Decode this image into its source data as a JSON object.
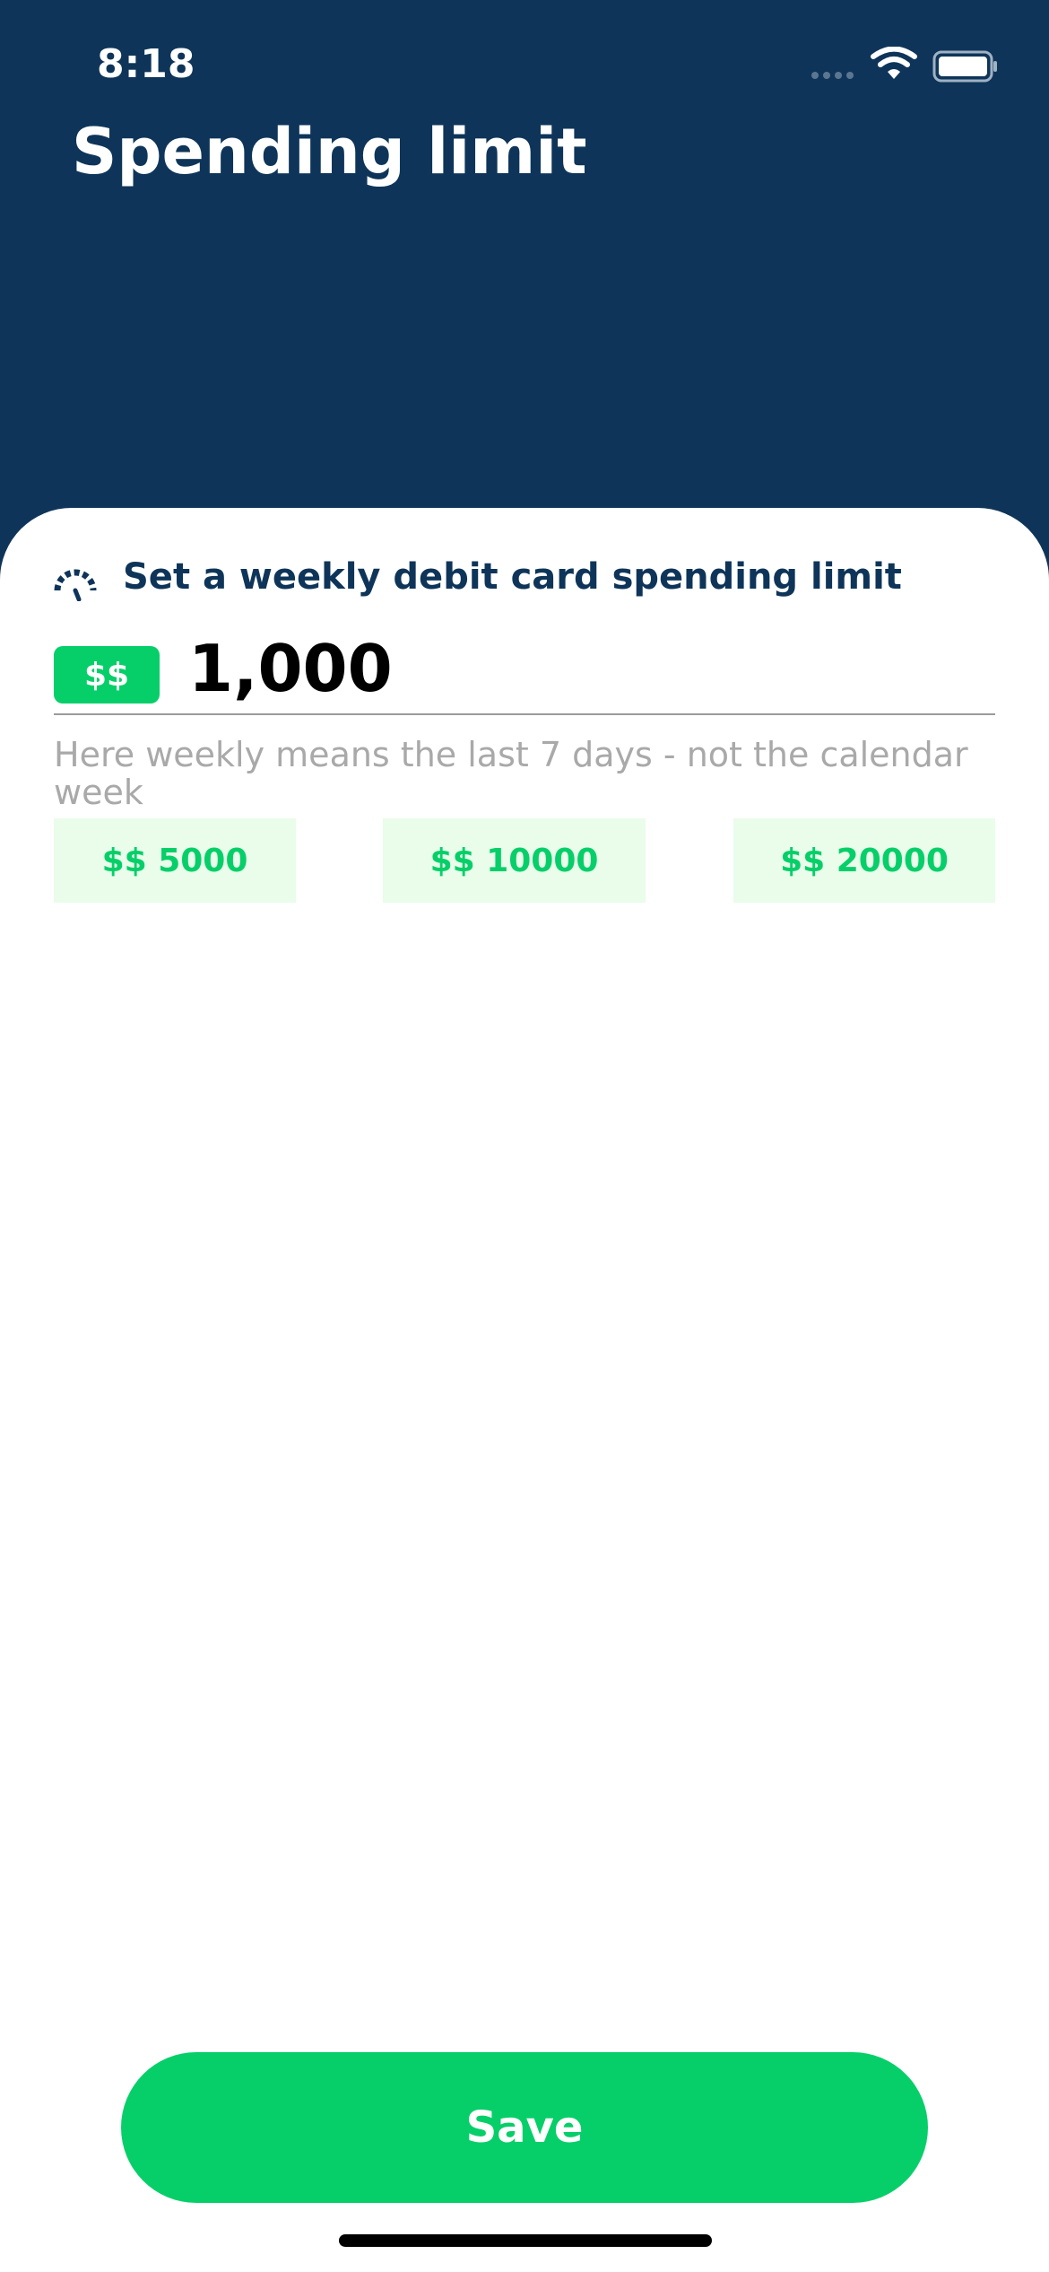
{
  "status_bar": {
    "time": "8:18",
    "icons": [
      "signal-dots-icon",
      "wifi-icon",
      "battery-icon"
    ]
  },
  "header": {
    "title": "Spending limit"
  },
  "limit_section": {
    "icon": "speedometer-icon",
    "title": "Set a weekly debit card spending limit",
    "currency_label": "$$",
    "amount_value": "1,000",
    "helper_text": "Here weekly means the last 7 days - not the calendar week"
  },
  "presets": [
    {
      "label": "$$ 5000"
    },
    {
      "label": "$$ 10000"
    },
    {
      "label": "$$ 20000"
    }
  ],
  "actions": {
    "save_label": "Save"
  },
  "colors": {
    "header_background": "#0e3559",
    "accent_green": "#06cf69",
    "preset_background": "#e9fdea",
    "helper_text": "#a9a9a9"
  }
}
